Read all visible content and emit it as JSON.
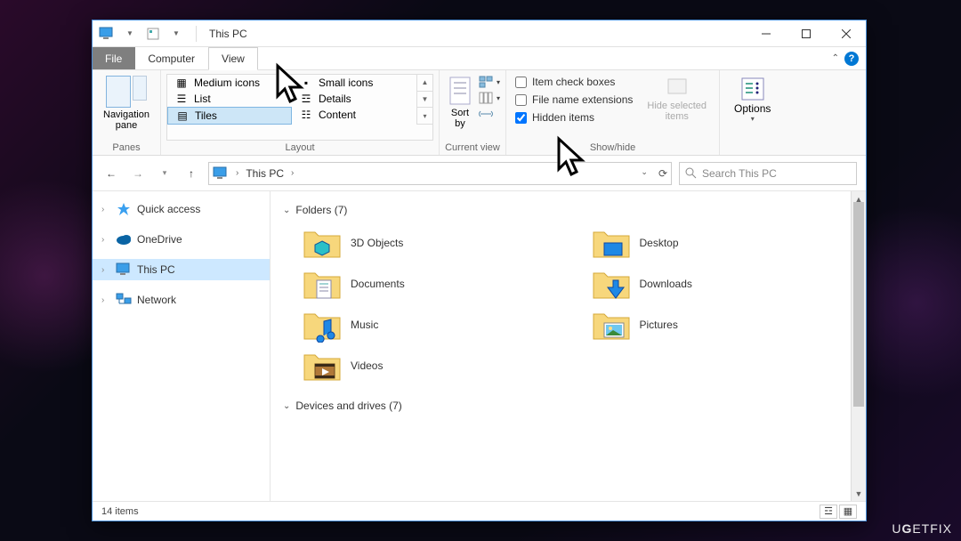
{
  "window": {
    "title": "This PC"
  },
  "tabs": {
    "file": "File",
    "computer": "Computer",
    "view": "View"
  },
  "ribbon": {
    "panes": {
      "nav_label": "Navigation\npane",
      "group_label": "Panes"
    },
    "layout": {
      "medium": "Medium icons",
      "small": "Small icons",
      "list": "List",
      "details": "Details",
      "tiles": "Tiles",
      "content": "Content",
      "group_label": "Layout"
    },
    "current_view": {
      "sort_by": "Sort\nby",
      "group_by": "",
      "add_columns": "",
      "size_columns": "",
      "group_label": "Current view"
    },
    "show_hide": {
      "item_check_boxes": "Item check boxes",
      "file_name_ext": "File name extensions",
      "hidden_items": "Hidden items",
      "hide_selected": "Hide selected\nitems",
      "group_label": "Show/hide"
    },
    "options": {
      "label": "Options"
    }
  },
  "address": {
    "location": "This PC"
  },
  "search": {
    "placeholder": "Search This PC"
  },
  "sidebar": {
    "quick_access": "Quick access",
    "onedrive": "OneDrive",
    "this_pc": "This PC",
    "network": "Network"
  },
  "content": {
    "folders_header": "Folders (7)",
    "devices_header": "Devices and drives (7)",
    "folders": [
      {
        "label": "3D Objects"
      },
      {
        "label": "Desktop"
      },
      {
        "label": "Documents"
      },
      {
        "label": "Downloads"
      },
      {
        "label": "Music"
      },
      {
        "label": "Pictures"
      },
      {
        "label": "Videos"
      }
    ]
  },
  "status": {
    "items": "14 items"
  },
  "watermark": "UGETFIX"
}
